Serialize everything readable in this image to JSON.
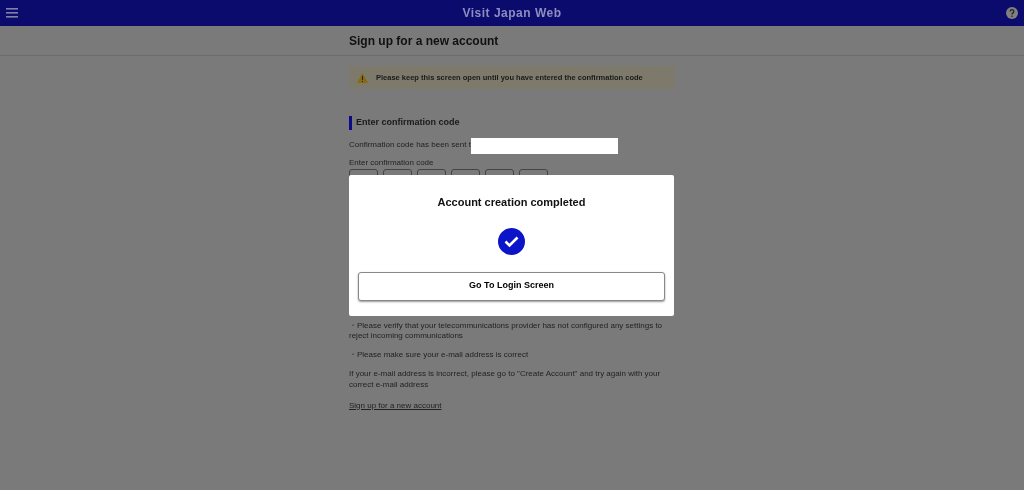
{
  "header": {
    "title": "Visit Japan Web"
  },
  "page": {
    "title": "Sign up for a new account",
    "notice": "Please keep this screen open until you have entered the confirmation code",
    "section_title": "Enter confirmation code",
    "sent_to": "Confirmation code has been sent t",
    "code_label": "Enter confirmation code",
    "code_fields": [
      {
        "kind": "digit"
      },
      {
        "kind": "digit"
      },
      {
        "kind": "digit"
      },
      {
        "kind": "digit"
      },
      {
        "kind": "digit"
      },
      {
        "kind": "digit"
      }
    ],
    "notes": [
      "・Please verify that your telecommunications provider has not configured any settings to reject incoming communications",
      "・Please make sure your e-mail address is correct"
    ],
    "help_text": "If your e-mail address is incorrect, please go to \"Create Account\" and try again with your correct e-mail address",
    "link": "Sign up for a new account"
  },
  "dialog": {
    "title": "Account creation completed",
    "button": "Go To Login Screen"
  }
}
